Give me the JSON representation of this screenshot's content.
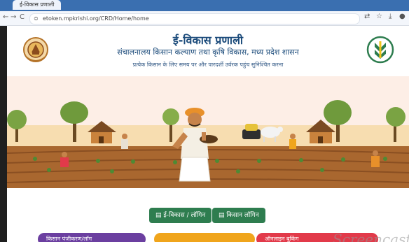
{
  "browser": {
    "tab_title": "ई-विकास प्रणाली",
    "url": "etoken.mpkrishi.org/CRD/Home/home",
    "nav_back": "←",
    "nav_forward": "→",
    "nav_reload": "C",
    "lock_icon": "⊜"
  },
  "header": {
    "title": "ई-विकास प्रणाली",
    "subtitle": "संचालनालय किसान कल्याण तथा कृषि विकास, मध्य प्रदेश शासन",
    "tagline": "प्रत्येक किसान के लिए समय पर और पारदर्शी उर्वरक पहुंच सुनिश्चित करना"
  },
  "buttons": {
    "evikas_login": "ई-विकास / लॉगिन",
    "kisan_login": "किसान लॉगिन"
  },
  "bottom_pills": [
    {
      "label": "किसान पंजीकरण/लॉग",
      "color": "#6b3fa0"
    },
    {
      "label": "",
      "color": "#f0a51c"
    },
    {
      "label": "ऑनलाइन बुकिंग",
      "color": "#e23a4a"
    }
  ],
  "colors": {
    "primary_blue": "#1a4a7a",
    "button_green": "#2e7d4f",
    "sky": "#fdeee6",
    "soil": "#a9672f"
  },
  "watermark": "Screencast"
}
